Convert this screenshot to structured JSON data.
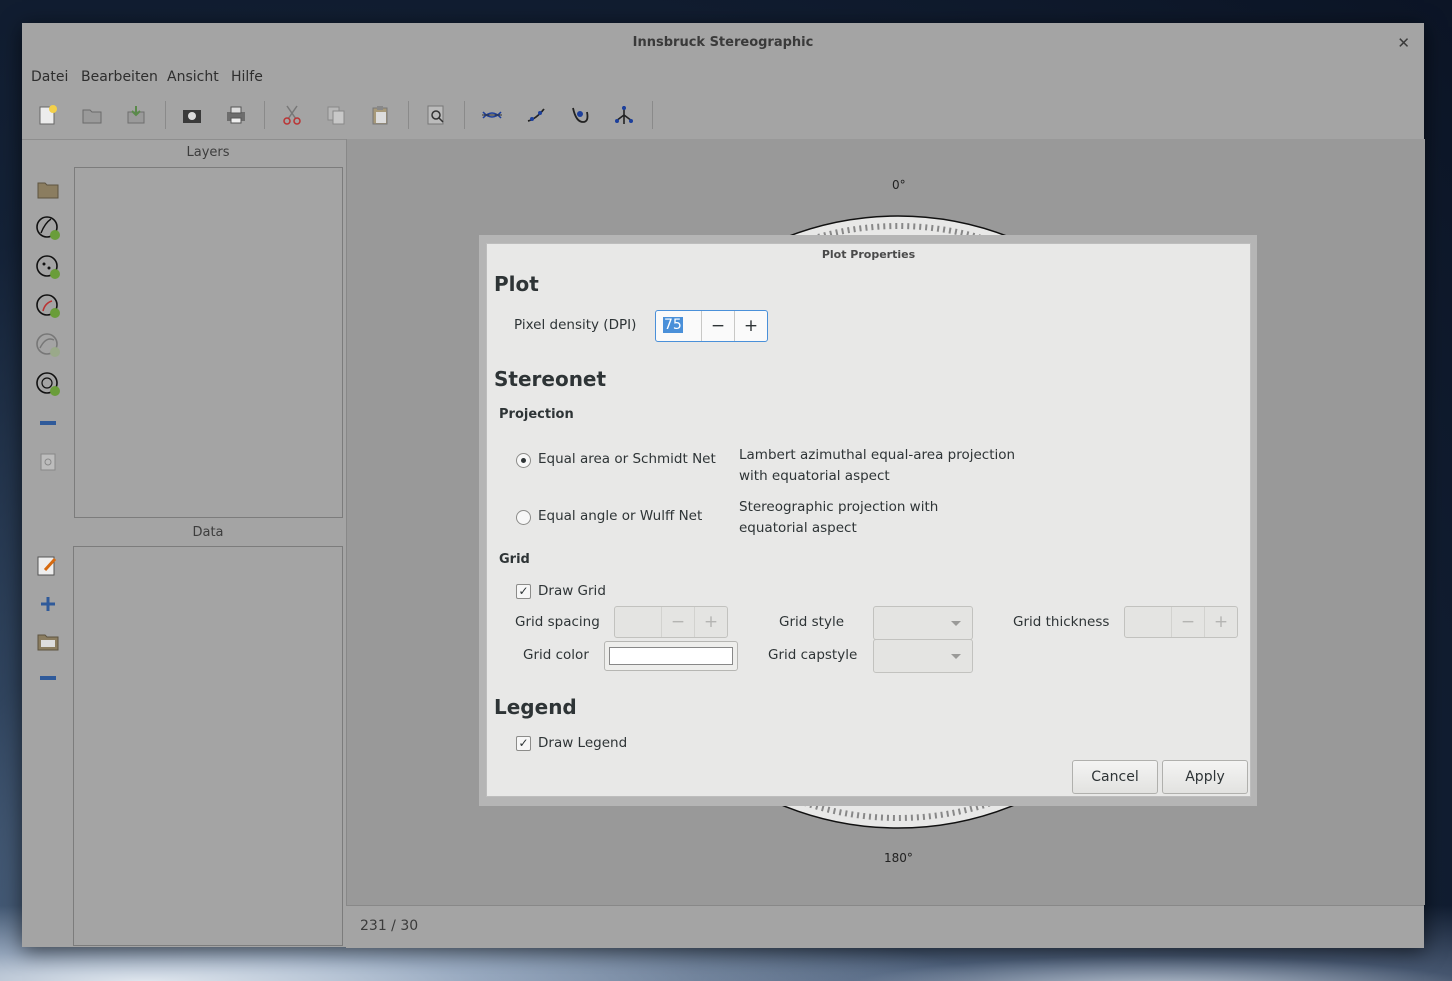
{
  "window": {
    "title": "Innsbruck Stereographic"
  },
  "menu": [
    "Datei",
    "Bearbeiten",
    "Ansicht",
    "Hilfe"
  ],
  "panels": {
    "layers_label": "Layers",
    "data_label": "Data"
  },
  "canvas": {
    "north_label": "0°",
    "south_label": "180°"
  },
  "status": {
    "coords": "231 / 30"
  },
  "dialog": {
    "title": "Plot Properties",
    "plot_heading": "Plot",
    "pixel_density_label": "Pixel density (DPI)",
    "pixel_density_value": "75",
    "stereonet_heading": "Stereonet",
    "projection_heading": "Projection",
    "projection_options": [
      {
        "label": "Equal area or Schmidt Net",
        "desc_line1": "Lambert azimuthal equal-area projection",
        "desc_line2": "with equatorial aspect",
        "selected": true
      },
      {
        "label": "Equal angle or Wulff Net",
        "desc_line1": "Stereographic projection with",
        "desc_line2": "equatorial aspect",
        "selected": false
      }
    ],
    "grid_heading": "Grid",
    "draw_grid_label": "Draw Grid",
    "draw_grid_checked": true,
    "grid_spacing_label": "Grid spacing",
    "grid_style_label": "Grid style",
    "grid_thickness_label": "Grid thickness",
    "grid_color_label": "Grid color",
    "grid_color_value": "#ffffff",
    "grid_capstyle_label": "Grid capstyle",
    "legend_heading": "Legend",
    "draw_legend_label": "Draw Legend",
    "draw_legend_checked": true,
    "cancel_label": "Cancel",
    "apply_label": "Apply"
  }
}
